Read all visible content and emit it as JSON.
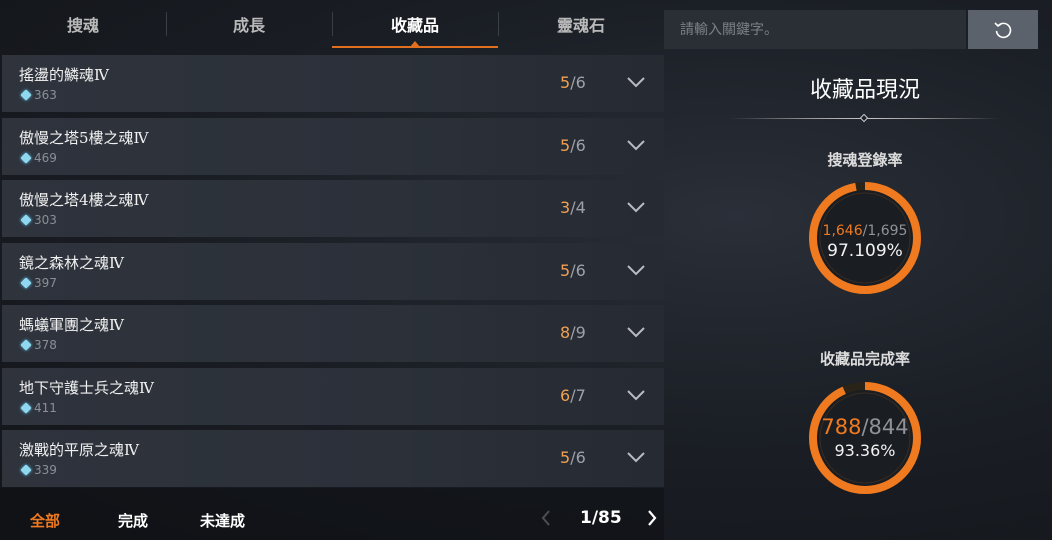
{
  "tabs": [
    {
      "label": "搜魂",
      "active": false
    },
    {
      "label": "成長",
      "active": false
    },
    {
      "label": "收藏品",
      "active": true
    },
    {
      "label": "靈魂石",
      "active": false
    }
  ],
  "items": [
    {
      "title": "搖盪的鱗魂Ⅳ",
      "points": "363",
      "current": "5",
      "total": "6"
    },
    {
      "title": "傲慢之塔5樓之魂Ⅳ",
      "points": "469",
      "current": "5",
      "total": "6"
    },
    {
      "title": "傲慢之塔4樓之魂Ⅳ",
      "points": "303",
      "current": "3",
      "total": "4"
    },
    {
      "title": "鏡之森林之魂Ⅳ",
      "points": "397",
      "current": "5",
      "total": "6"
    },
    {
      "title": "螞蟻軍團之魂Ⅳ",
      "points": "378",
      "current": "8",
      "total": "9"
    },
    {
      "title": "地下守護士兵之魂Ⅳ",
      "points": "411",
      "current": "6",
      "total": "7"
    },
    {
      "title": "激戰的平原之魂Ⅳ",
      "points": "339",
      "current": "5",
      "total": "6"
    }
  ],
  "filters": [
    {
      "label": "全部",
      "active": true
    },
    {
      "label": "完成",
      "active": false
    },
    {
      "label": "未達成",
      "active": false
    }
  ],
  "pager": {
    "text": "1/85"
  },
  "search": {
    "placeholder": "請輸入關鍵字。"
  },
  "panel": {
    "title": "收藏品現況",
    "soul_rate": {
      "label": "搜魂登錄率",
      "current": "1,646",
      "total": "1,695",
      "percent_text": "97.109%",
      "fraction": 0.97109
    },
    "collection_rate": {
      "label": "收藏品完成率",
      "current": "788",
      "total": "844",
      "percent_text": "93.36%",
      "fraction": 0.9336
    }
  },
  "colors": {
    "accent": "#f07a20",
    "count_current": "#f0a050",
    "ring_track": "#3a2a20"
  },
  "icons": {
    "row_expand": "chevron-down-icon",
    "refresh": "refresh-icon",
    "points": "soul-gem-icon"
  }
}
